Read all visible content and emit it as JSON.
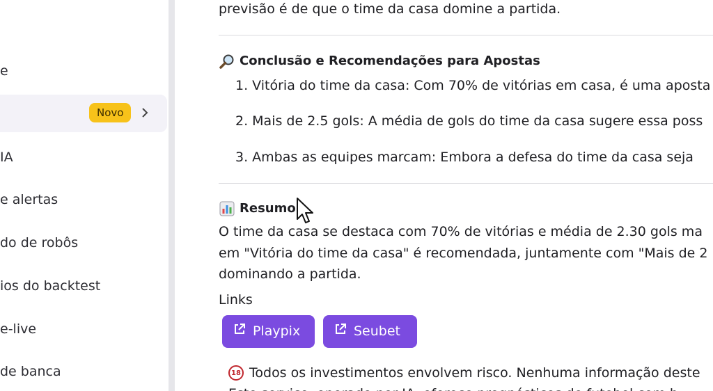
{
  "sidebar": {
    "items": [
      {
        "label": "e"
      },
      {
        "label": "",
        "badge": "Novo"
      },
      {
        "label": "IA"
      },
      {
        "label": "e alertas"
      },
      {
        "label": "do de robôs"
      },
      {
        "label": "ios do backtest"
      },
      {
        "label": "e-live"
      },
      {
        "label": "de banca"
      }
    ]
  },
  "content": {
    "top_text": "previsão é de que o time da casa domine a partida.",
    "conclusion_heading": "Conclusão e Recomendações para Apostas",
    "recommendations": [
      "1. Vitória do time da casa: Com 70% de vitórias em casa, é uma aposta",
      "2. Mais de 2.5 gols: A média de gols do time da casa sugere essa poss",
      "3. Ambas as equipes marcam: Embora a defesa do time da casa seja"
    ],
    "summary_heading": "Resumo",
    "summary_lines": [
      "O time da casa se destaca com 70% de vitórias e média de 2.30 gols ma",
      "em \"Vitória do time da casa\" é recomendada, juntamente com \"Mais de 2",
      "dominando a partida."
    ],
    "links_label": "Links",
    "links": [
      {
        "label": "Playpix"
      },
      {
        "label": "Seubet"
      }
    ],
    "disclaimer_lines": [
      "Todos os investimentos envolvem risco. Nenhuma informação deste",
      "Este serviço, operado por IA, oferece prognósticos de futebol com b"
    ],
    "age_badge": "18"
  },
  "colors": {
    "accent": "#7b4be0",
    "badge": "#f7c21a",
    "sidebar_active": "#f3f2f8"
  }
}
